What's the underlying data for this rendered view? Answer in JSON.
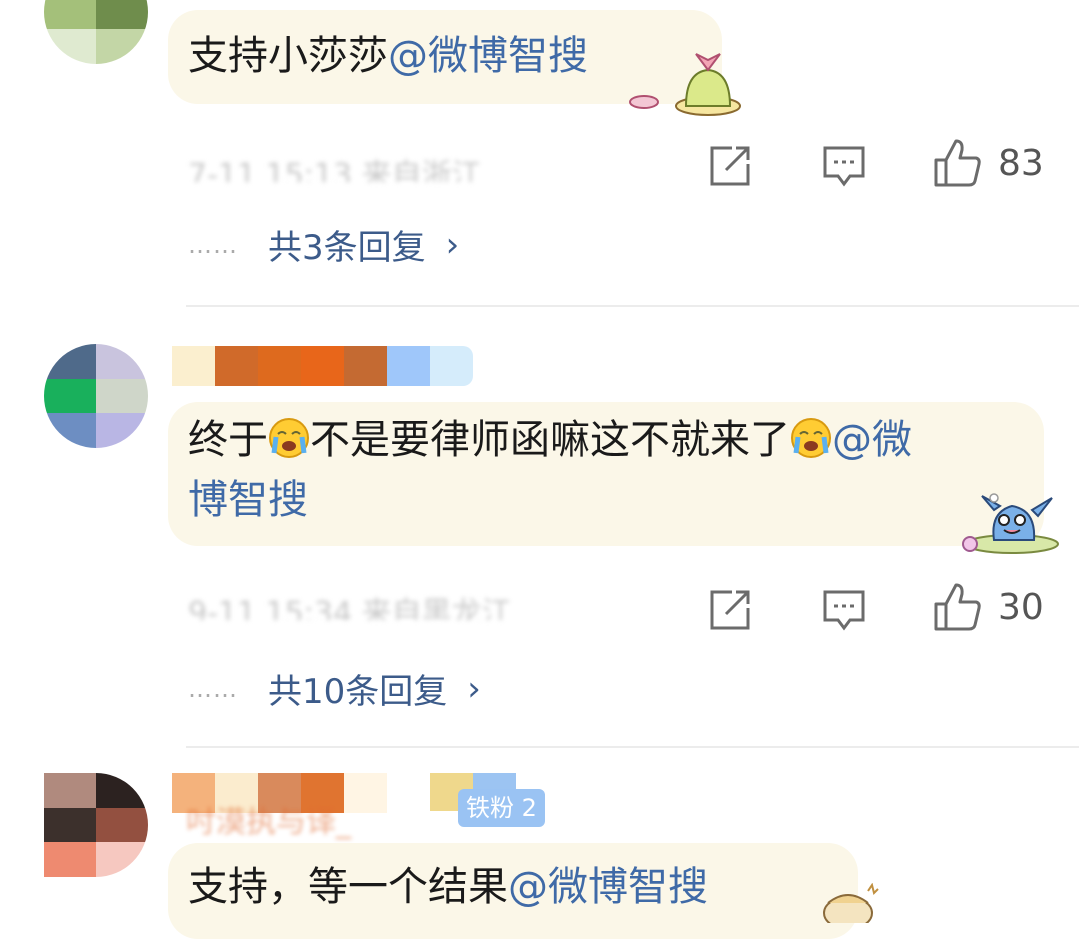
{
  "colors": {
    "mention": "#3f6aa7",
    "reply_link": "#3c5b8a",
    "bubble_bg": "#fbf7e8",
    "divider": "#ececec"
  },
  "comments": [
    {
      "text": "支持小莎莎",
      "mention": "@微博智搜",
      "likes": "83",
      "replies_label": "共3条回复",
      "dots": "……",
      "meta_blurred": "7-11 15:13 来自浙江"
    },
    {
      "text_a": "终于",
      "text_b": "不是要律师函嘛这不就来了",
      "mention_a": "@微",
      "mention_b": "博智搜",
      "likes": "30",
      "replies_label": "共10条回复",
      "dots": "……",
      "meta_blurred": "9-11 15:34 来自黑龙江"
    },
    {
      "username_blurred": "吋漠执与译_",
      "fan_badge": "铁粉 2",
      "text": "支持，等一个结果",
      "mention": "@微博智搜"
    }
  ],
  "icons": {
    "share": "share-icon",
    "comment": "comment-icon",
    "like": "thumbs-up-icon",
    "chevron": "›"
  }
}
